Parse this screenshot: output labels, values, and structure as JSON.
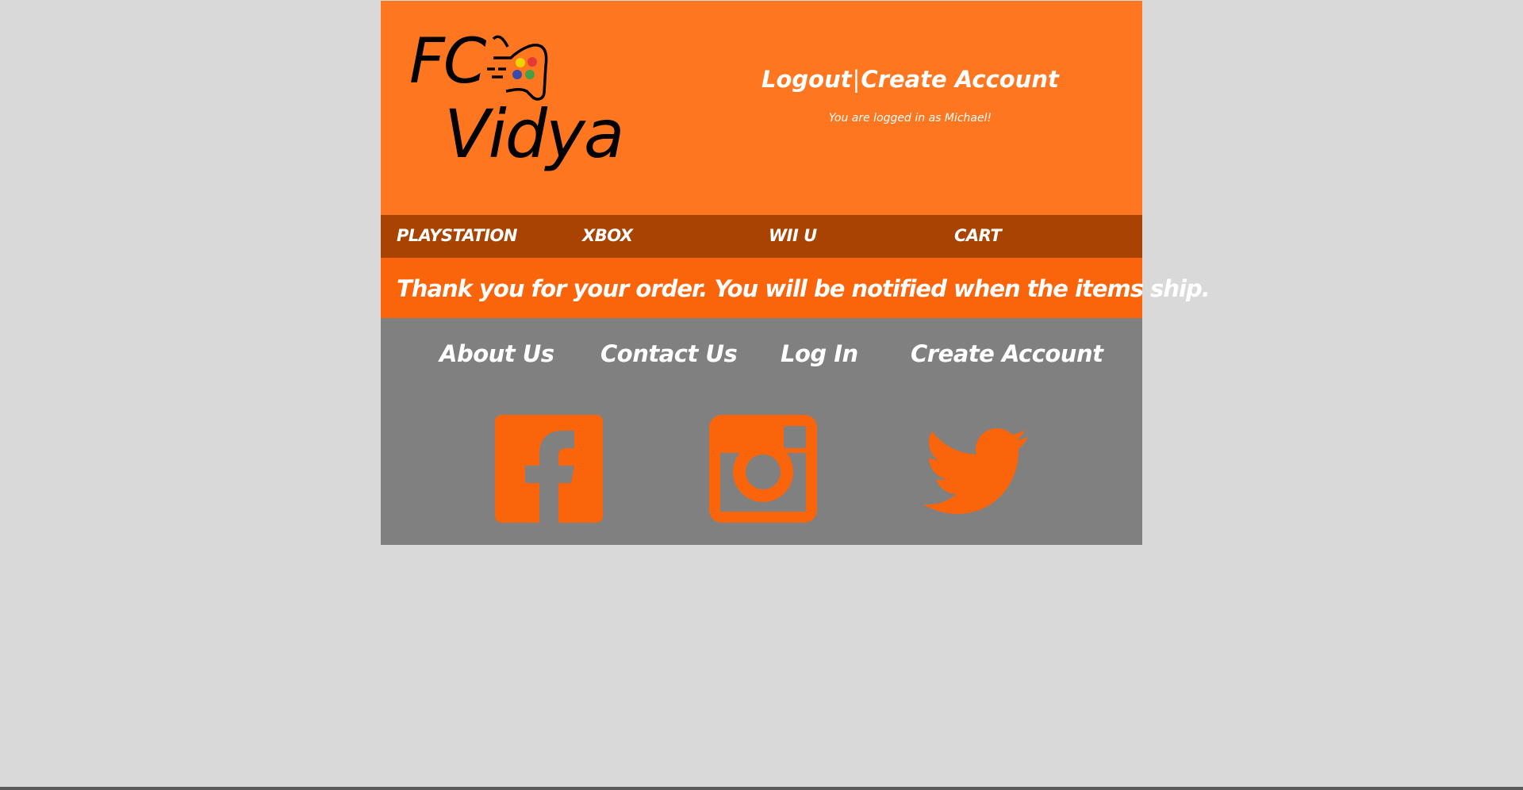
{
  "brand": {
    "line1": "FC",
    "line2": "Vidya"
  },
  "header": {
    "logout_label": "Logout",
    "separator": "|",
    "create_account_label": "Create Account",
    "logged_in_text": "You are logged in as Michael!"
  },
  "nav": {
    "items": [
      {
        "label": "PLAYSTATION"
      },
      {
        "label": "XBOX"
      },
      {
        "label": "WII U"
      },
      {
        "label": "CART"
      }
    ]
  },
  "message": {
    "text": "Thank you for your order. You will be notified when the items ship."
  },
  "footer": {
    "links": [
      {
        "label": "About Us"
      },
      {
        "label": "Contact Us"
      },
      {
        "label": "Log In"
      },
      {
        "label": "Create Account"
      }
    ],
    "social": [
      {
        "icon": "facebook-icon"
      },
      {
        "icon": "instagram-icon"
      },
      {
        "icon": "twitter-icon"
      }
    ]
  },
  "colors": {
    "header_bg": "#fe7720",
    "nav_bg": "#a84302",
    "message_bg": "#fa640a",
    "footer_bg": "#808080",
    "page_bg": "#d9d9d9",
    "social_icon": "#fa640a"
  }
}
